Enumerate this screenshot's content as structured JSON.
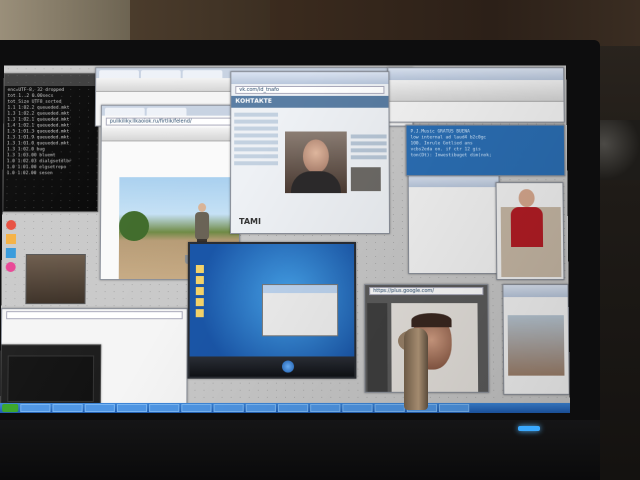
{
  "scene": {
    "description_colors": {
      "screen_bg": "#c9c9c9",
      "taskbar": "#1d5aae",
      "power_led": "#3aa9ff"
    }
  },
  "terminal": {
    "lines": [
      "enc=UTF-8, 32 dropped",
      "tot  1..2  0.00secs",
      "tot Size  UTF8 sorted",
      "1.1  1:02.2 queueded.mkt",
      "1.3  1:02.2 queueded.mkt",
      "1.3  1:02.1 queueded.mkt",
      "1.4  1:02.1 queueded.mkt",
      "1.5  1:01.3 queueded.mkt",
      "1.3  1:01.9 queueded.mkt",
      "1.3  1:01.0 queueded.mkt",
      "1.3  1:02.0 bug",
      "1.3  1:03.00 bluemt",
      "1.0  1:02.03 dialgsetdlbr",
      "1.0  1:01.00 elgsetrepo",
      "1.0  1:02.00 sesen"
    ]
  },
  "vk": {
    "logo": "КОНТАКТЕ",
    "address": "vk.com/id_tnafo",
    "brand": "TAMI"
  },
  "photo_window": {
    "address": "pulikiliky.llkaoiok.ru/firtlik/felend/"
  },
  "blue_doc": {
    "lines": [
      "P.J.Music GRATUS BUENA",
      "low internal ad laud4 b2c0gc",
      "      100. Inrule Gotlied ans",
      "  vcbs2eda on. if ctr 12 gis",
      "  ton(Dt): Inwestibuget dim(nok;"
    ]
  },
  "ps_window": {
    "address": "https://plus.google.com/"
  }
}
